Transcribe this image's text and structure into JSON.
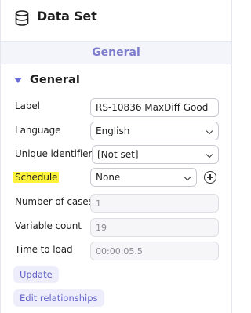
{
  "header": {
    "title": "Data Set",
    "icon": "database-icon"
  },
  "tab": {
    "label": "General"
  },
  "section": {
    "title": "General"
  },
  "form": {
    "label": {
      "caption": "Label",
      "value": "RS-10836 MaxDiff Good"
    },
    "language": {
      "caption": "Language",
      "value": "English"
    },
    "unique_identifier": {
      "caption": "Unique identifier",
      "value": "[Not set]"
    },
    "schedule": {
      "caption": "Schedule",
      "value": "None"
    },
    "number_of_cases": {
      "caption": "Number of cases",
      "value": "1"
    },
    "variable_count": {
      "caption": "Variable count",
      "value": "19"
    },
    "time_to_load": {
      "caption": "Time to load",
      "value": "00:00:05.5"
    }
  },
  "buttons": {
    "update": "Update",
    "edit_relationships": "Edit relationships"
  },
  "colors": {
    "accent": "#7c7ccc",
    "highlight": "#fff23a",
    "button_bg": "#ededfb"
  }
}
